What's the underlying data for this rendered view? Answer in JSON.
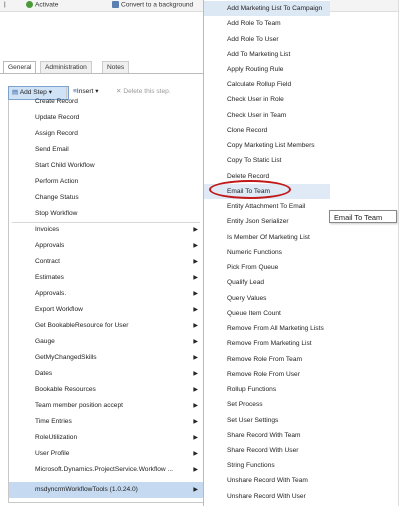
{
  "topbar": {
    "activate_label": "Activate",
    "convert_label": "Convert to a background"
  },
  "tabs": [
    {
      "label": "General"
    },
    {
      "label": "Administration"
    },
    {
      "label": "Notes"
    }
  ],
  "toolbar": {
    "add_step_label": "Add Step",
    "insert_label": "Insert",
    "delete_label": "Delete this step."
  },
  "left_menu": {
    "items": [
      {
        "label": "Create Record",
        "submenu": false
      },
      {
        "label": "Update Record",
        "submenu": false
      },
      {
        "label": "Assign Record",
        "submenu": false
      },
      {
        "label": "Send Email",
        "submenu": false
      },
      {
        "label": "Start Child Workflow",
        "submenu": false
      },
      {
        "label": "Perform Action",
        "submenu": false
      },
      {
        "label": "Change Status",
        "submenu": false
      },
      {
        "label": "Stop Workflow",
        "submenu": false
      },
      {
        "label": "Invoices",
        "submenu": true
      },
      {
        "label": "Approvals",
        "submenu": true
      },
      {
        "label": "Contract",
        "submenu": true
      },
      {
        "label": "Estimates",
        "submenu": true
      },
      {
        "label": "Approvals.",
        "submenu": true
      },
      {
        "label": "Export Workflow",
        "submenu": true
      },
      {
        "label": "Get BookableResource for User",
        "submenu": true
      },
      {
        "label": "Gauge",
        "submenu": true
      },
      {
        "label": "GetMyChangedSkills",
        "submenu": true
      },
      {
        "label": "Dates",
        "submenu": true
      },
      {
        "label": "Bookable Resources",
        "submenu": true
      },
      {
        "label": "Team member position accept",
        "submenu": true
      },
      {
        "label": "Time Entries",
        "submenu": true
      },
      {
        "label": "RoleUtilization",
        "submenu": true
      },
      {
        "label": "User Profile",
        "submenu": true
      },
      {
        "label": "Microsoft.Dynamics.ProjectService.Workflow ...",
        "submenu": true
      },
      {
        "label": "msdyncrmWorkflowTools (1.0.24.0)",
        "submenu": true,
        "selected": true
      }
    ]
  },
  "submenu": {
    "items": [
      {
        "label": "Add Marketing List To Campaign"
      },
      {
        "label": "Add Role To Team"
      },
      {
        "label": "Add Role To User"
      },
      {
        "label": "Add To Marketing List"
      },
      {
        "label": "Apply Routing Rule"
      },
      {
        "label": "Calculate Rollup Field"
      },
      {
        "label": "Check User in Role"
      },
      {
        "label": "Check User in Team"
      },
      {
        "label": "Clone Record"
      },
      {
        "label": "Copy Marketing List Members"
      },
      {
        "label": "Copy To Static List"
      },
      {
        "label": "Delete Record"
      },
      {
        "label": "Email To Team"
      },
      {
        "label": "Entity Attachment To Email"
      },
      {
        "label": "Entity Json Serializer"
      },
      {
        "label": "Is Member Of Marketing List"
      },
      {
        "label": "Numeric Functions"
      },
      {
        "label": "Pick From Queue"
      },
      {
        "label": "Qualify Lead"
      },
      {
        "label": "Query Values"
      },
      {
        "label": "Queue Item Count"
      },
      {
        "label": "Remove From All Marketing Lists"
      },
      {
        "label": "Remove From Marketing List"
      },
      {
        "label": "Remove Role From Team"
      },
      {
        "label": "Remove Role From User"
      },
      {
        "label": "Rollup Functions"
      },
      {
        "label": "Set Process"
      },
      {
        "label": "Set User Settings"
      },
      {
        "label": "Share Record With Team"
      },
      {
        "label": "Share Record With User"
      },
      {
        "label": "String Functions"
      },
      {
        "label": "Unshare Record With Team"
      },
      {
        "label": "Unshare Record With User"
      }
    ]
  },
  "tooltip": {
    "text": "Email To Team"
  },
  "colors": {
    "selected_row": "#c5daf0",
    "hover_row": "#dfeaf6",
    "highlight_circle": "#c01818",
    "add_step_bg": "#cfe2f6"
  }
}
